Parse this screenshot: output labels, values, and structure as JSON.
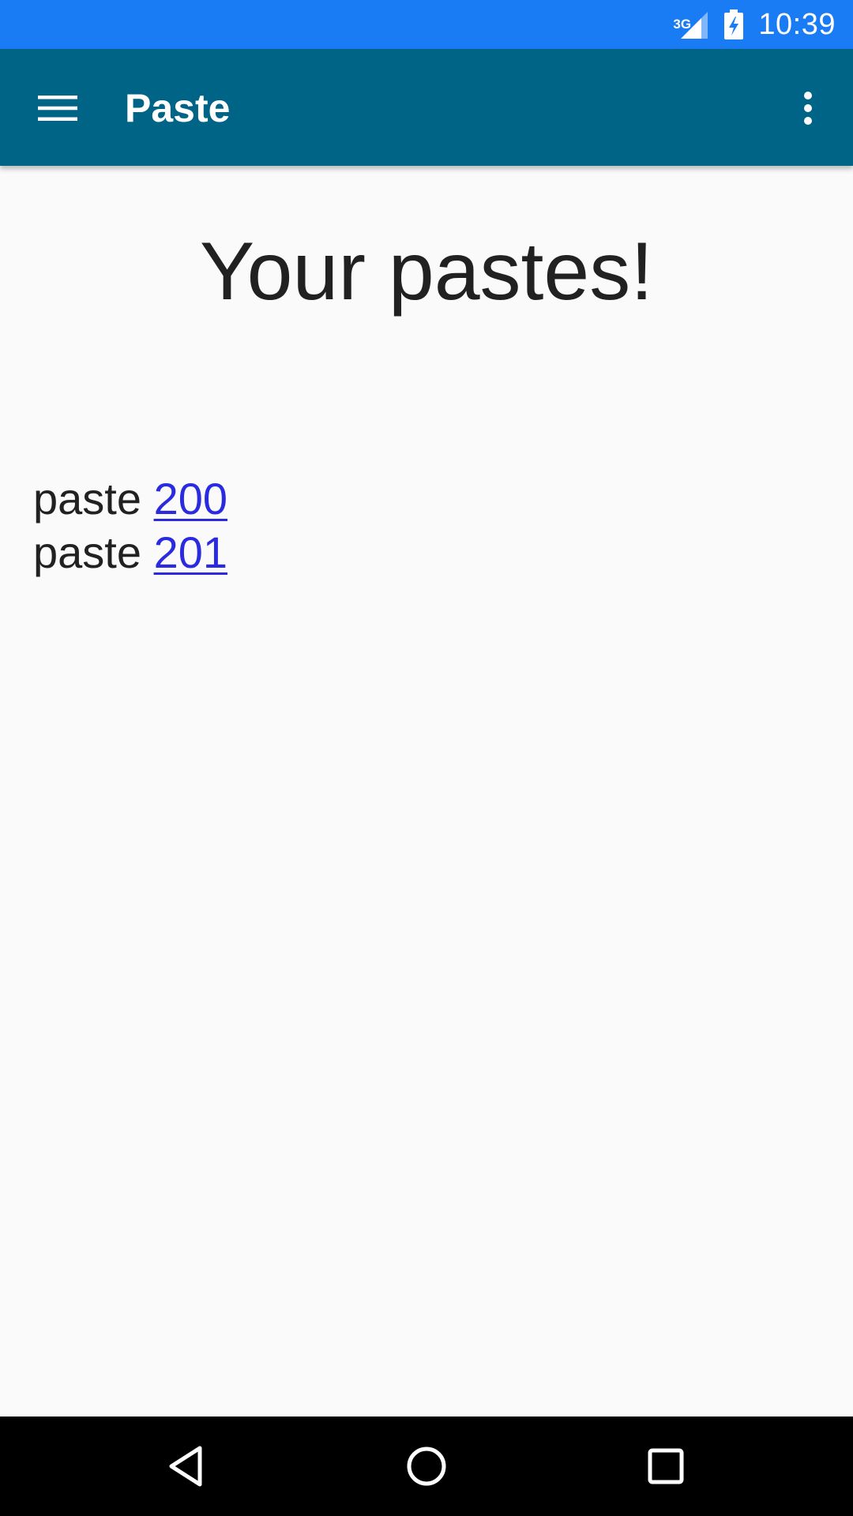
{
  "status_bar": {
    "network": "3G",
    "time": "10:39",
    "icons": [
      "signal-icon",
      "battery-charging-icon"
    ]
  },
  "app_bar": {
    "title": "Paste",
    "menu_icon": "hamburger-menu-icon",
    "overflow_icon": "more-vertical-icon"
  },
  "main": {
    "heading": "Your pastes!",
    "pastes": [
      {
        "prefix": "paste",
        "link": "200"
      },
      {
        "prefix": "paste",
        "link": "201"
      }
    ]
  },
  "nav_bar": {
    "icons": [
      "back-icon",
      "home-icon",
      "recents-icon"
    ]
  },
  "colors": {
    "status_bar": "#1a7cf5",
    "app_bar": "#006487",
    "link": "#2a2ae0",
    "background": "#fafafa"
  }
}
